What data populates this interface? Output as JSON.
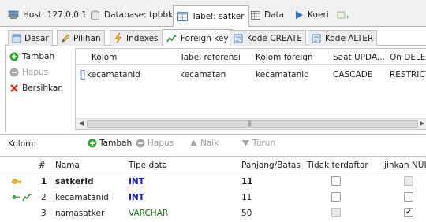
{
  "top_tabs": {
    "host": "Host: 127.0.0.1",
    "database": "Database: tpbbk",
    "table": "Tabel: satker",
    "data": "Data",
    "query": "Kueri"
  },
  "sub_tabs": {
    "basic": "Dasar",
    "options": "Pilihan",
    "indexes": "Indexes",
    "foreign_key": "Foreign key",
    "create_code": "Kode CREATE",
    "alter_code": "Kode ALTER"
  },
  "fk_actions": {
    "add": "Tambah",
    "delete": "Hapus",
    "clear": "Bersihkan"
  },
  "fk_table": {
    "columns": [
      "Kolom",
      "Tabel referensi",
      "Kolom foreign",
      "Saat UPDA...",
      "On DELETE"
    ],
    "rows": [
      [
        "kecamatanid",
        "kecamatan",
        "kecamatanid",
        "CASCADE",
        "RESTRICT"
      ]
    ]
  },
  "columns_section": {
    "label": "Kolom:",
    "add": "Tambah",
    "delete": "Hapus",
    "up": "Naik",
    "down": "Turun"
  },
  "columns_table": {
    "headers": [
      "#",
      "Nama",
      "Tipe data",
      "Panjang/Batas",
      "Tidak terdaftar",
      "Ijinkan NULL"
    ],
    "rows": [
      {
        "num": "1",
        "name": "satkerid",
        "type": "INT",
        "length": "11",
        "unsigned": false,
        "allow_null": false
      },
      {
        "num": "2",
        "name": "kecamatanid",
        "type": "INT",
        "length": "11",
        "unsigned": false,
        "allow_null": false
      },
      {
        "num": "3",
        "name": "namasatker",
        "type": "VARCHAR",
        "length": "50",
        "unsigned": false,
        "allow_null": true
      }
    ]
  },
  "colors": {
    "int_type": "#1414c8",
    "varchar_type": "#147514",
    "add_green": "#2fa82f",
    "delete_red": "#d63a2a"
  }
}
